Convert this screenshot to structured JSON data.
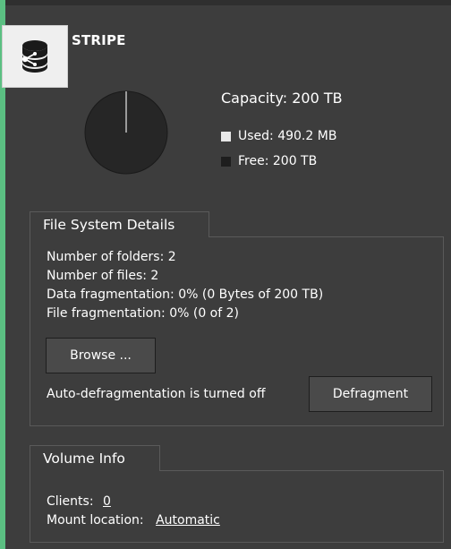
{
  "volume": {
    "name": "STRIPE",
    "icon": "database-network-icon",
    "capacity_label": "Capacity: 200 TB",
    "used_label": "Used: 490.2 MB",
    "free_label": "Free: 200 TB",
    "used_fraction": 2.4e-06
  },
  "colors": {
    "accent": "#5bbf82",
    "background": "#3d3d3d",
    "used": "#e8e8e8",
    "free": "#1e1e1e"
  },
  "file_system": {
    "title": "File System Details",
    "folders": "Number of folders: 2",
    "files": "Number of files: 2",
    "data_frag": "Data fragmentation: 0% (0 Bytes of 200 TB)",
    "file_frag": "File fragmentation: 0% (0 of 2)",
    "browse_label": "Browse ...",
    "auto_defrag": "Auto-defragmentation is turned off",
    "defrag_label": "Defragment"
  },
  "volume_info": {
    "title": "Volume Info",
    "clients_label": "Clients:",
    "clients_value": "0",
    "mount_label": "Mount location:",
    "mount_value": "Automatic"
  }
}
